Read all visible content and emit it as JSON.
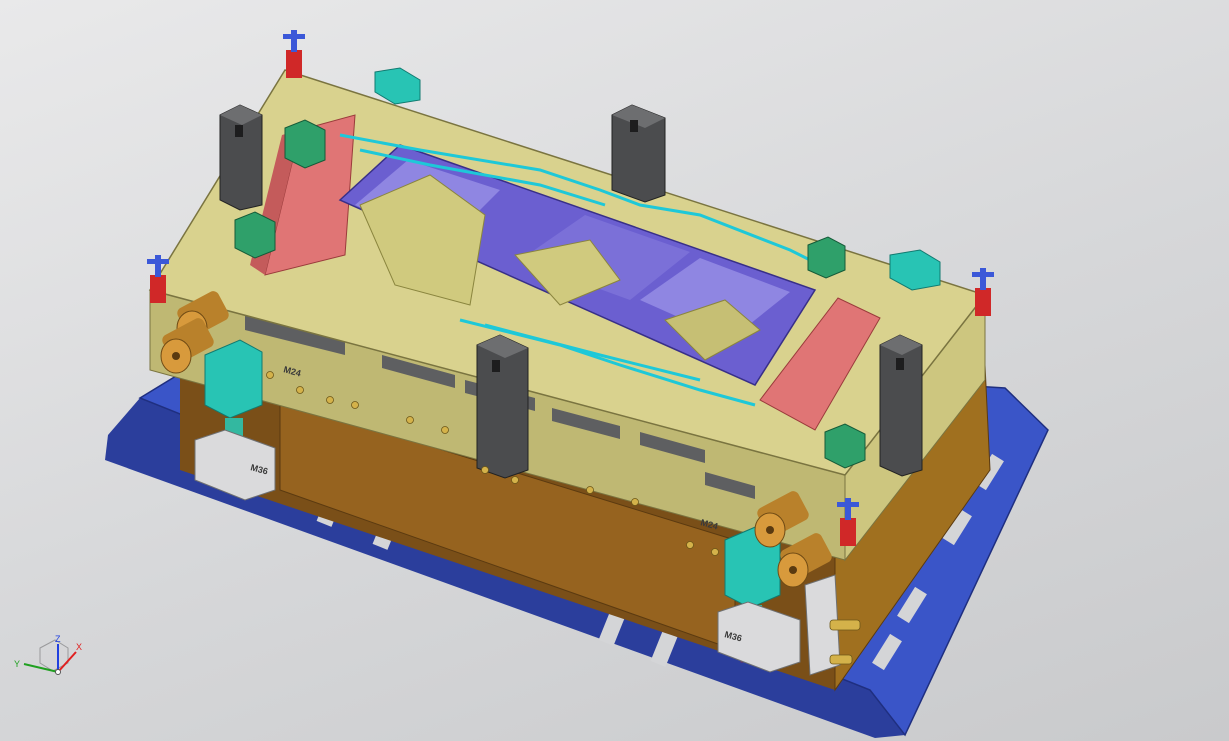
{
  "viewport": {
    "background_top": "#e9e9ea",
    "background_bottom": "#c9cacc"
  },
  "model": {
    "part_stamps": [
      {
        "id": "stamp-m24-left",
        "text": "M24"
      },
      {
        "id": "stamp-m24-right",
        "text": "M24"
      },
      {
        "id": "stamp-m36-left",
        "text": "M36"
      },
      {
        "id": "stamp-m36-right",
        "text": "M36"
      }
    ],
    "colors": {
      "base_plate": "#3a55c8",
      "upper_plate": "#d9d28e",
      "side_plate": "#8a5a1e",
      "insert": "#6b5fd0",
      "cooling_lines": "#1ec8d8",
      "slider_blocks": "#e07575",
      "guide_bushings": "#b9812b",
      "cylinders": "#28c4b4",
      "pillars": "#505152"
    }
  },
  "triad": {
    "x_label": "X",
    "y_label": "Y",
    "z_label": "Z",
    "x_color": "#e02020",
    "y_color": "#20a020",
    "z_color": "#2040e0"
  }
}
